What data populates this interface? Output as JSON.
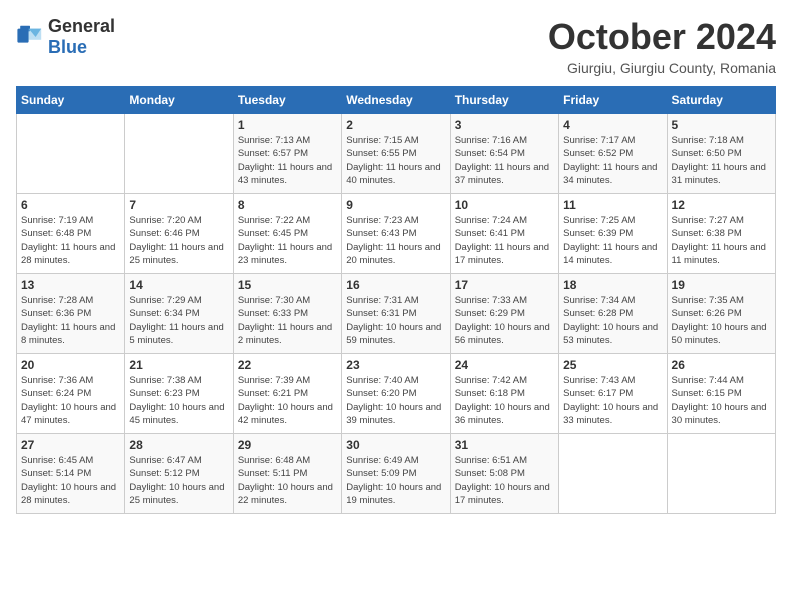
{
  "header": {
    "logo_general": "General",
    "logo_blue": "Blue",
    "month_year": "October 2024",
    "location": "Giurgiu, Giurgiu County, Romania"
  },
  "days_of_week": [
    "Sunday",
    "Monday",
    "Tuesday",
    "Wednesday",
    "Thursday",
    "Friday",
    "Saturday"
  ],
  "weeks": [
    [
      {
        "day": "",
        "content": ""
      },
      {
        "day": "",
        "content": ""
      },
      {
        "day": "1",
        "content": "Sunrise: 7:13 AM\nSunset: 6:57 PM\nDaylight: 11 hours and 43 minutes."
      },
      {
        "day": "2",
        "content": "Sunrise: 7:15 AM\nSunset: 6:55 PM\nDaylight: 11 hours and 40 minutes."
      },
      {
        "day": "3",
        "content": "Sunrise: 7:16 AM\nSunset: 6:54 PM\nDaylight: 11 hours and 37 minutes."
      },
      {
        "day": "4",
        "content": "Sunrise: 7:17 AM\nSunset: 6:52 PM\nDaylight: 11 hours and 34 minutes."
      },
      {
        "day": "5",
        "content": "Sunrise: 7:18 AM\nSunset: 6:50 PM\nDaylight: 11 hours and 31 minutes."
      }
    ],
    [
      {
        "day": "6",
        "content": "Sunrise: 7:19 AM\nSunset: 6:48 PM\nDaylight: 11 hours and 28 minutes."
      },
      {
        "day": "7",
        "content": "Sunrise: 7:20 AM\nSunset: 6:46 PM\nDaylight: 11 hours and 25 minutes."
      },
      {
        "day": "8",
        "content": "Sunrise: 7:22 AM\nSunset: 6:45 PM\nDaylight: 11 hours and 23 minutes."
      },
      {
        "day": "9",
        "content": "Sunrise: 7:23 AM\nSunset: 6:43 PM\nDaylight: 11 hours and 20 minutes."
      },
      {
        "day": "10",
        "content": "Sunrise: 7:24 AM\nSunset: 6:41 PM\nDaylight: 11 hours and 17 minutes."
      },
      {
        "day": "11",
        "content": "Sunrise: 7:25 AM\nSunset: 6:39 PM\nDaylight: 11 hours and 14 minutes."
      },
      {
        "day": "12",
        "content": "Sunrise: 7:27 AM\nSunset: 6:38 PM\nDaylight: 11 hours and 11 minutes."
      }
    ],
    [
      {
        "day": "13",
        "content": "Sunrise: 7:28 AM\nSunset: 6:36 PM\nDaylight: 11 hours and 8 minutes."
      },
      {
        "day": "14",
        "content": "Sunrise: 7:29 AM\nSunset: 6:34 PM\nDaylight: 11 hours and 5 minutes."
      },
      {
        "day": "15",
        "content": "Sunrise: 7:30 AM\nSunset: 6:33 PM\nDaylight: 11 hours and 2 minutes."
      },
      {
        "day": "16",
        "content": "Sunrise: 7:31 AM\nSunset: 6:31 PM\nDaylight: 10 hours and 59 minutes."
      },
      {
        "day": "17",
        "content": "Sunrise: 7:33 AM\nSunset: 6:29 PM\nDaylight: 10 hours and 56 minutes."
      },
      {
        "day": "18",
        "content": "Sunrise: 7:34 AM\nSunset: 6:28 PM\nDaylight: 10 hours and 53 minutes."
      },
      {
        "day": "19",
        "content": "Sunrise: 7:35 AM\nSunset: 6:26 PM\nDaylight: 10 hours and 50 minutes."
      }
    ],
    [
      {
        "day": "20",
        "content": "Sunrise: 7:36 AM\nSunset: 6:24 PM\nDaylight: 10 hours and 47 minutes."
      },
      {
        "day": "21",
        "content": "Sunrise: 7:38 AM\nSunset: 6:23 PM\nDaylight: 10 hours and 45 minutes."
      },
      {
        "day": "22",
        "content": "Sunrise: 7:39 AM\nSunset: 6:21 PM\nDaylight: 10 hours and 42 minutes."
      },
      {
        "day": "23",
        "content": "Sunrise: 7:40 AM\nSunset: 6:20 PM\nDaylight: 10 hours and 39 minutes."
      },
      {
        "day": "24",
        "content": "Sunrise: 7:42 AM\nSunset: 6:18 PM\nDaylight: 10 hours and 36 minutes."
      },
      {
        "day": "25",
        "content": "Sunrise: 7:43 AM\nSunset: 6:17 PM\nDaylight: 10 hours and 33 minutes."
      },
      {
        "day": "26",
        "content": "Sunrise: 7:44 AM\nSunset: 6:15 PM\nDaylight: 10 hours and 30 minutes."
      }
    ],
    [
      {
        "day": "27",
        "content": "Sunrise: 6:45 AM\nSunset: 5:14 PM\nDaylight: 10 hours and 28 minutes."
      },
      {
        "day": "28",
        "content": "Sunrise: 6:47 AM\nSunset: 5:12 PM\nDaylight: 10 hours and 25 minutes."
      },
      {
        "day": "29",
        "content": "Sunrise: 6:48 AM\nSunset: 5:11 PM\nDaylight: 10 hours and 22 minutes."
      },
      {
        "day": "30",
        "content": "Sunrise: 6:49 AM\nSunset: 5:09 PM\nDaylight: 10 hours and 19 minutes."
      },
      {
        "day": "31",
        "content": "Sunrise: 6:51 AM\nSunset: 5:08 PM\nDaylight: 10 hours and 17 minutes."
      },
      {
        "day": "",
        "content": ""
      },
      {
        "day": "",
        "content": ""
      }
    ]
  ]
}
